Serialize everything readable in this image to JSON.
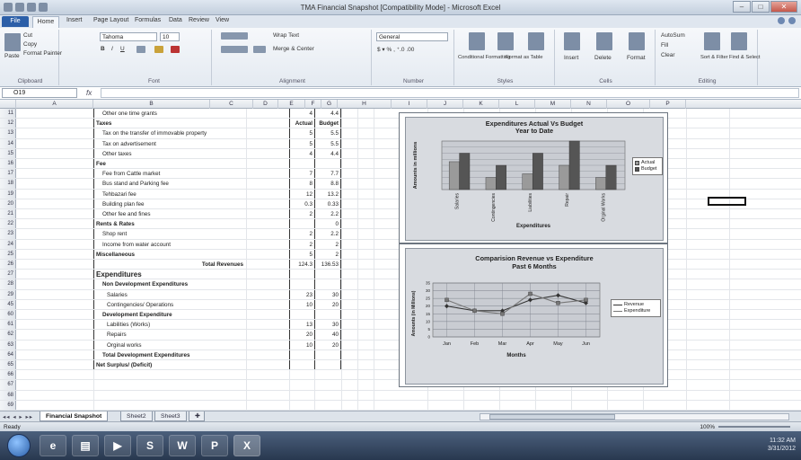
{
  "window": {
    "title": "TMA Financial Snapshot [Compatibility Mode] - Microsoft Excel"
  },
  "ribbon_tabs": [
    "File",
    "Home",
    "Insert",
    "Page Layout",
    "Formulas",
    "Data",
    "Review",
    "View"
  ],
  "ribbon": {
    "clipboard": {
      "cut": "Cut",
      "copy": "Copy",
      "paste": "Paste",
      "format_painter": "Format Painter",
      "label": "Clipboard"
    },
    "font": {
      "name": "Tahoma",
      "size": "10",
      "label": "Font"
    },
    "alignment": {
      "wrap": "Wrap Text",
      "merge": "Merge & Center",
      "label": "Alignment"
    },
    "number": {
      "format": "General",
      "label": "Number"
    },
    "styles": {
      "conditional": "Conditional Formatting",
      "format_table": "Format as Table",
      "cell_styles": "Cell Styles",
      "label": "Styles"
    },
    "cells": {
      "insert": "Insert",
      "delete": "Delete",
      "format": "Format",
      "label": "Cells"
    },
    "editing": {
      "autosum": "AutoSum",
      "fill": "Fill",
      "clear": "Clear",
      "sort": "Sort & Filter",
      "find": "Find & Select",
      "label": "Editing"
    }
  },
  "formula_bar": {
    "name_box": "O19",
    "fx": "fx",
    "value": ""
  },
  "columns": [
    "A",
    "B",
    "C",
    "D",
    "E",
    "F",
    "G",
    "H",
    "I",
    "J",
    "K",
    "L",
    "M",
    "N",
    "O",
    "P"
  ],
  "rows": [
    {
      "n": "11",
      "b": "Other one time grants",
      "d": "4",
      "e": "4.4",
      "style": "i1"
    },
    {
      "n": "12",
      "b": "Taxes",
      "d": "Actual",
      "e": "Budget",
      "style": "bold"
    },
    {
      "n": "13",
      "b": "Tax on the transfer of immovable property",
      "d": "5",
      "e": "5.5",
      "style": "i1"
    },
    {
      "n": "14",
      "b": "Tax on advertisement",
      "d": "5",
      "e": "5.5",
      "style": "i1"
    },
    {
      "n": "15",
      "b": "Other taxes",
      "d": "4",
      "e": "4.4",
      "style": "i1"
    },
    {
      "n": "16",
      "b": "Fee",
      "d": "",
      "e": "",
      "style": "bold"
    },
    {
      "n": "17",
      "b": "Fee from Cattle market",
      "d": "7",
      "e": "7.7",
      "style": "i1"
    },
    {
      "n": "18",
      "b": "Bus stand and Parking fee",
      "d": "8",
      "e": "8.8",
      "style": "i1"
    },
    {
      "n": "19",
      "b": "Tehbazari fee",
      "d": "12",
      "e": "13.2",
      "style": "i1"
    },
    {
      "n": "20",
      "b": "Building plan fee",
      "d": "0.3",
      "e": "0.33",
      "style": "i1"
    },
    {
      "n": "21",
      "b": "Other fee and fines",
      "d": "2",
      "e": "2.2",
      "style": "i1"
    },
    {
      "n": "22",
      "b": "Rents & Rates",
      "d": "",
      "e": "0",
      "style": "bold"
    },
    {
      "n": "23",
      "b": "Shop rent",
      "d": "2",
      "e": "2.2",
      "style": "i1"
    },
    {
      "n": "24",
      "b": "Income from water account",
      "d": "2",
      "e": "2",
      "style": "i1"
    },
    {
      "n": "25",
      "b": "Miscellaneous",
      "d": "5",
      "e": "2",
      "style": "bold"
    },
    {
      "n": "26",
      "b": "Total Revenues",
      "d": "124.3",
      "e": "136.53",
      "style": "total"
    },
    {
      "n": "27",
      "b": "Expenditures",
      "d": "",
      "e": "",
      "style": "big"
    },
    {
      "n": "28",
      "b": "Non Development Expenditures",
      "d": "",
      "e": "",
      "style": "bi1"
    },
    {
      "n": "29",
      "b": "Salaries",
      "d": "23",
      "e": "30",
      "style": "i2"
    },
    {
      "n": "45",
      "b": "Contingencies/ Operations",
      "d": "10",
      "e": "20",
      "style": "i2"
    },
    {
      "n": "60",
      "b": "Development Expenditure",
      "d": "",
      "e": "",
      "style": "bi1"
    },
    {
      "n": "61",
      "b": "Labilities (Works)",
      "d": "13",
      "e": "30",
      "style": "i2"
    },
    {
      "n": "62",
      "b": "Repairs",
      "d": "20",
      "e": "40",
      "style": "i2"
    },
    {
      "n": "63",
      "b": "Orginal works",
      "d": "10",
      "e": "20",
      "style": "i2"
    },
    {
      "n": "64",
      "b": "Total Development Expenditures",
      "d": "",
      "e": "",
      "style": "bi1"
    },
    {
      "n": "65",
      "b": "Net Surplus/ (Deficit)",
      "d": "",
      "e": "",
      "style": "bold"
    },
    {
      "n": "66",
      "b": "",
      "d": "",
      "e": "",
      "style": ""
    },
    {
      "n": "67",
      "b": "",
      "d": "",
      "e": "",
      "style": ""
    },
    {
      "n": "68",
      "b": "",
      "d": "",
      "e": "",
      "style": ""
    },
    {
      "n": "69",
      "b": "",
      "d": "",
      "e": "",
      "style": ""
    }
  ],
  "chart_data": [
    {
      "type": "bar",
      "title": "Expenditures  Actual Vs Budget",
      "subtitle": "Year to Date",
      "xlabel": "Expenditures",
      "ylabel": "Amounts in millions",
      "categories": [
        "Salaries",
        "Contingencies",
        "Liabilities",
        "Repair",
        "Orginal Works"
      ],
      "series": [
        {
          "name": "Actual",
          "values": [
            23,
            10,
            13,
            20,
            10
          ],
          "color": "#9a9a9a"
        },
        {
          "name": "Budget",
          "values": [
            30,
            20,
            30,
            40,
            20
          ],
          "color": "#555555"
        }
      ],
      "ylim": [
        0,
        40
      ],
      "legend": "right"
    },
    {
      "type": "line",
      "title": "Comparision  Revenue vs Expenditure",
      "subtitle": "Past 6 Months",
      "xlabel": "Months",
      "ylabel": "Amounts (in Millions)",
      "categories": [
        "Jan",
        "Feb",
        "Mar",
        "Apr",
        "May",
        "Jun"
      ],
      "series": [
        {
          "name": "Revenue",
          "values": [
            20,
            17,
            17,
            24,
            27,
            22
          ],
          "marker": "diamond"
        },
        {
          "name": "Expenditure",
          "values": [
            24,
            17,
            15,
            28,
            22,
            24
          ],
          "marker": "square"
        }
      ],
      "ylim": [
        0,
        35
      ],
      "yticks": [
        0,
        5,
        10,
        15,
        20,
        25,
        30,
        35
      ],
      "legend": "right"
    }
  ],
  "sheets": [
    "Financial Snapshot",
    "Sheet2",
    "Sheet3"
  ],
  "status": {
    "ready": "Ready",
    "zoom": "100%"
  },
  "taskbar": {
    "time": "11:32 AM",
    "date": "3/31/2012"
  }
}
